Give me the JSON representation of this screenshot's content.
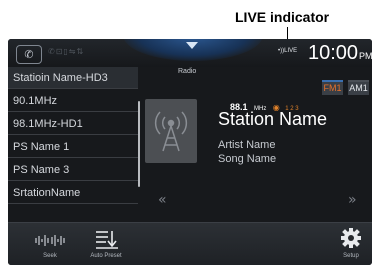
{
  "annotation": {
    "label": "LIVE indicator"
  },
  "topbar": {
    "source_title": "Radio",
    "live_indicator": "LIVE",
    "clock": {
      "time": "10:00",
      "ampm": "PM"
    },
    "bands": [
      {
        "label": "FM1",
        "active": true
      },
      {
        "label": "AM1",
        "active": false
      }
    ],
    "icons": [
      "phone-icon",
      "status-icons",
      "source-dropdown-arrow"
    ]
  },
  "station_list": {
    "items": [
      "Statioin Name-HD3",
      "90.1MHz",
      "98.1MHz-HD1",
      "PS Name 1",
      "PS Name 3",
      "SrtationName"
    ]
  },
  "now_playing": {
    "frequency": "88.1",
    "unit": "MHz",
    "hd_channels": "1 2 3",
    "station_name": "Station Name",
    "artist": "Artist Name",
    "song": "Song Name"
  },
  "bottombar": {
    "seek_label": "Seek",
    "autopreset_label": "Auto Preset",
    "setup_label": "Setup"
  },
  "colors": {
    "accent": "#e8712a",
    "background": "#17191c",
    "text": "#ffffff"
  }
}
